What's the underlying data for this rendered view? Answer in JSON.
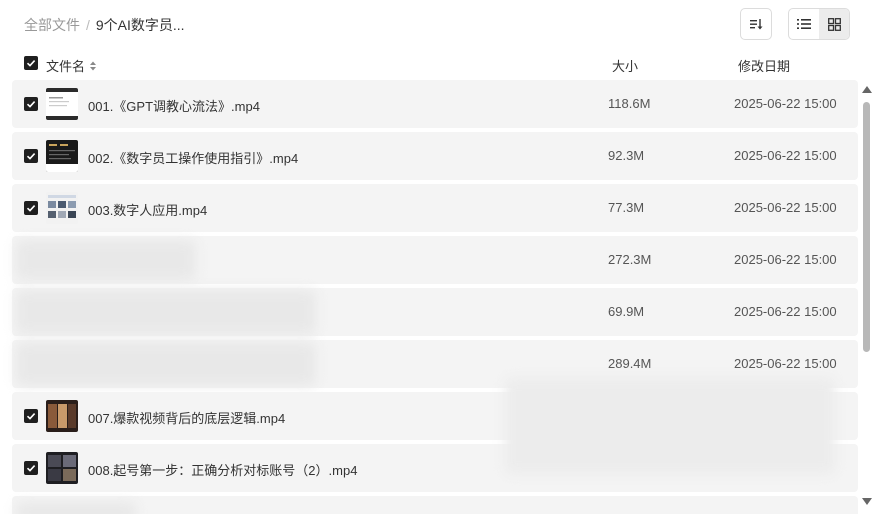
{
  "breadcrumb": {
    "root": "全部文件",
    "separator": "/",
    "current": "9个AI数字员..."
  },
  "toolbar": {
    "sort_icon": "sort-icon",
    "list_view_icon": "list-view-icon",
    "grid_view_icon": "grid-view-icon",
    "active_view": "list"
  },
  "columns": {
    "name": "文件名",
    "size": "大小",
    "modified": "修改日期"
  },
  "files": [
    {
      "name": "001.《GPT调教心流法》.mp4",
      "size": "118.6M",
      "date": "2025-06-22 15:00",
      "checked": true
    },
    {
      "name": "002.《数字员工操作使用指引》.mp4",
      "size": "92.3M",
      "date": "2025-06-22 15:00",
      "checked": true
    },
    {
      "name": "003.数字人应用.mp4",
      "size": "77.3M",
      "date": "2025-06-22 15:00",
      "checked": true
    },
    {
      "name": "",
      "size": "272.3M",
      "date": "2025-06-22 15:00",
      "checked": false
    },
    {
      "name": "",
      "size": "69.9M",
      "date": "2025-06-22 15:00",
      "checked": false
    },
    {
      "name": "",
      "size": "289.4M",
      "date": "2025-06-22 15:00",
      "checked": false
    },
    {
      "name": "007.爆款视频背后的底层逻辑.mp4",
      "size": "",
      "date": "",
      "checked": true
    },
    {
      "name": "008.起号第一步：正确分析对标账号（2）.mp4",
      "size": "",
      "date": "",
      "checked": true
    }
  ],
  "colors": {
    "row_bg": "#f4f4f4",
    "checkbox": "#1f1f1f",
    "text": "#333333"
  }
}
